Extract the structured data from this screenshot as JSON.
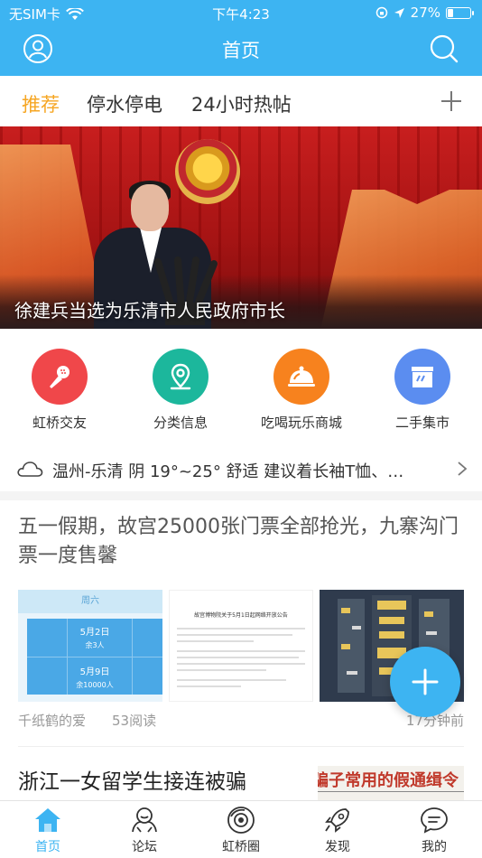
{
  "status_bar": {
    "carrier": "无SIM卡",
    "time": "下午4:23",
    "battery": "27%",
    "battery_level": 0.27
  },
  "header": {
    "title": "首页",
    "left_icon": "user-icon",
    "right_icon": "search-icon"
  },
  "tabs": {
    "items": [
      {
        "label": "推荐",
        "active": true
      },
      {
        "label": "停水停电",
        "active": false
      },
      {
        "label": "24小时热帖",
        "active": false
      }
    ],
    "add_icon": "plus-icon"
  },
  "banner": {
    "caption": "徐建兵当选为乐清市人民政府市长"
  },
  "shortcuts": [
    {
      "label": "虹桥交友",
      "icon": "microphone-icon",
      "color": "#F0474A"
    },
    {
      "label": "分类信息",
      "icon": "location-pin-icon",
      "color": "#1CB79C"
    },
    {
      "label": "吃喝玩乐商城",
      "icon": "food-cloche-icon",
      "color": "#F7821E"
    },
    {
      "label": "二手集市",
      "icon": "store-icon",
      "color": "#5B8DF0"
    }
  ],
  "weather": {
    "text": "温州-乐清 阴 19°~25° 舒适 建议着长袖T恤、…",
    "icon": "cloud-icon"
  },
  "article1": {
    "title": "五一假期，故宫25000张门票全部抢光，九寨沟门票一度售馨",
    "author": "千纸鹤的爱",
    "reads": "53阅读",
    "time": "17分钟前",
    "thumb1": {
      "header": "周六",
      "date1": "5月2日",
      "count1": "余3人",
      "date2": "5月9日",
      "count2": "余10000人"
    },
    "thumb2": {
      "title": "故宫博物院关于5月1日起网络开放公告"
    }
  },
  "article2": {
    "title": "浙江一女留学生接连被骗",
    "image_text": "骗子常用的假通缉令"
  },
  "fab": {
    "icon": "plus-icon"
  },
  "bottom_nav": [
    {
      "label": "首页",
      "icon": "home-icon",
      "active": true
    },
    {
      "label": "论坛",
      "icon": "forum-icon",
      "active": false
    },
    {
      "label": "虹桥圈",
      "icon": "circle-icon",
      "active": false
    },
    {
      "label": "发现",
      "icon": "rocket-icon",
      "active": false
    },
    {
      "label": "我的",
      "icon": "chat-bubble-icon",
      "active": false
    }
  ],
  "colors": {
    "primary": "#3DB4F2",
    "tab_active": "#F6A623"
  }
}
